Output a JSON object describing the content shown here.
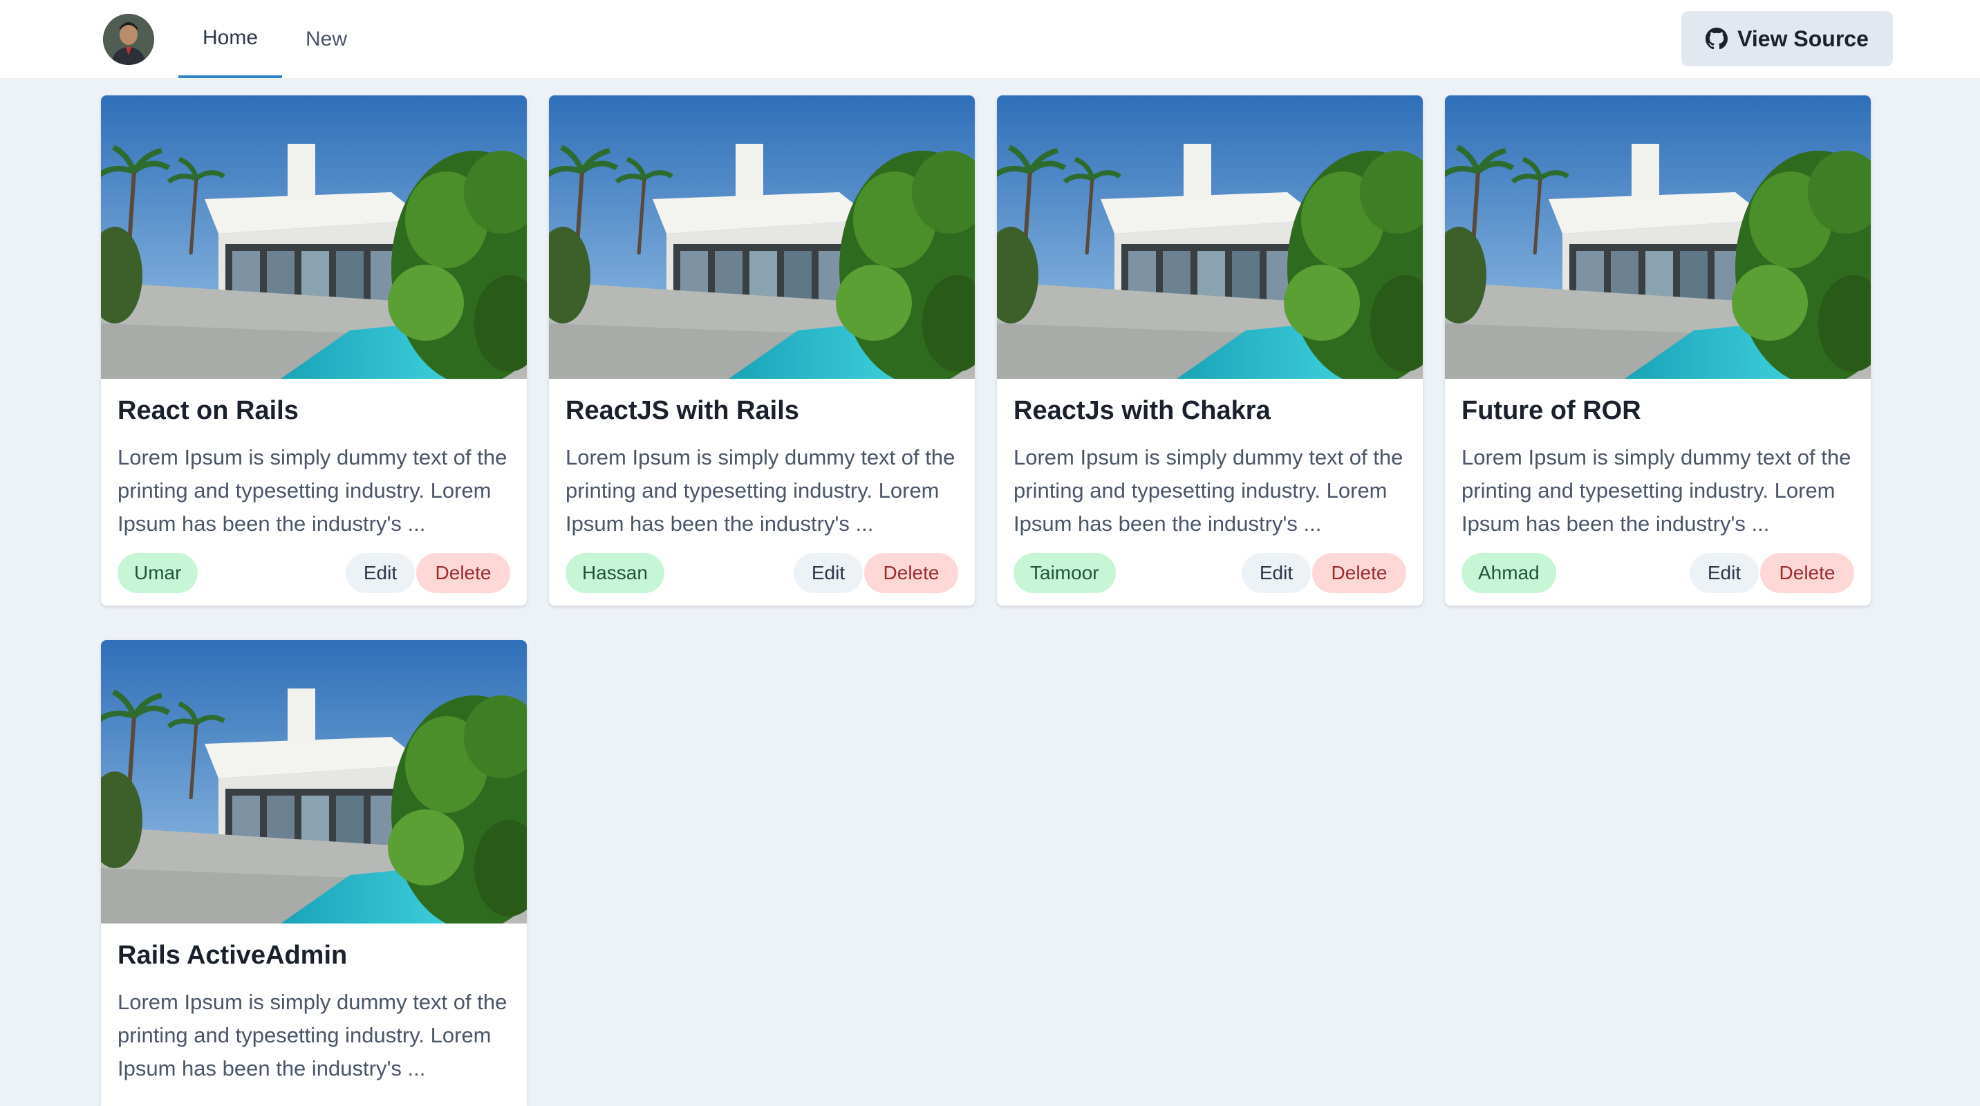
{
  "header": {
    "nav": [
      {
        "label": "Home",
        "active": true
      },
      {
        "label": "New",
        "active": false
      }
    ],
    "view_source_label": "View Source",
    "icons": {
      "avatar": "user-avatar",
      "github": "github-icon"
    }
  },
  "colors": {
    "accent": "#3182ce",
    "author_badge_bg": "#c6f6d5",
    "delete_bg": "#fed7d7",
    "edit_bg": "#edf2f7",
    "page_bg": "#edf2f7"
  },
  "cards": [
    {
      "title": "React on Rails",
      "description": "Lorem Ipsum is simply dummy text of the printing and typesetting industry. Lorem Ipsum has been the industry's ...",
      "author": "Umar",
      "edit_label": "Edit",
      "delete_label": "Delete"
    },
    {
      "title": "ReactJS with Rails",
      "description": "Lorem Ipsum is simply dummy text of the printing and typesetting industry. Lorem Ipsum has been the industry's ...",
      "author": "Hassan",
      "edit_label": "Edit",
      "delete_label": "Delete"
    },
    {
      "title": "ReactJs with Chakra",
      "description": "Lorem Ipsum is simply dummy text of the printing and typesetting industry. Lorem Ipsum has been the industry's ...",
      "author": "Taimoor",
      "edit_label": "Edit",
      "delete_label": "Delete"
    },
    {
      "title": "Future of ROR",
      "description": "Lorem Ipsum is simply dummy text of the printing and typesetting industry. Lorem Ipsum has been the industry's ...",
      "author": "Ahmad",
      "edit_label": "Edit",
      "delete_label": "Delete"
    },
    {
      "title": "Rails ActiveAdmin",
      "description": "Lorem Ipsum is simply dummy text of the printing and typesetting industry. Lorem Ipsum has been the industry's ...",
      "author": "",
      "edit_label": "",
      "delete_label": ""
    }
  ]
}
